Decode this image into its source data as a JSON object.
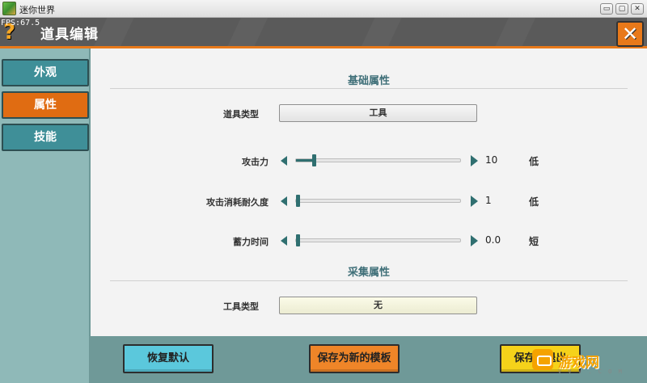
{
  "window": {
    "title": "迷你世界",
    "fps": "FPS:67.5",
    "buttons": {
      "minimize": "▭",
      "maximize": "▢",
      "close": "✕"
    }
  },
  "header": {
    "help_label": "?",
    "title": "道具编辑",
    "close_label": "✕"
  },
  "sidebar": {
    "tabs": [
      {
        "label": "外观",
        "active": false
      },
      {
        "label": "属性",
        "active": true
      },
      {
        "label": "技能",
        "active": false
      }
    ]
  },
  "basic_section": {
    "title": "基础属性",
    "item_type": {
      "label": "道具类型",
      "value": "工具"
    },
    "sliders": [
      {
        "label": "攻击力",
        "value": "10",
        "level": "低",
        "fraction": 0.1
      },
      {
        "label": "攻击消耗耐久度",
        "value": "1",
        "level": "低",
        "fraction": 0.0
      },
      {
        "label": "蓄力时间",
        "value": "0.0",
        "level": "短",
        "fraction": 0.0
      }
    ]
  },
  "gather_section": {
    "title": "采集属性",
    "tool_type": {
      "label": "工具类型",
      "value": "无"
    }
  },
  "footer": {
    "reset_label": "恢复默认",
    "save_template_label": "保存为新的模板",
    "save_label": "保存并退出"
  },
  "watermark": {
    "text": "游戏网",
    "sub": "V V V . C O M"
  },
  "colors": {
    "accent_orange": "#e06c12",
    "teal": "#3f8f98",
    "slider": "#2f6f70",
    "reset_button": "#5bc8dc",
    "save_button": "#f5d21a"
  }
}
